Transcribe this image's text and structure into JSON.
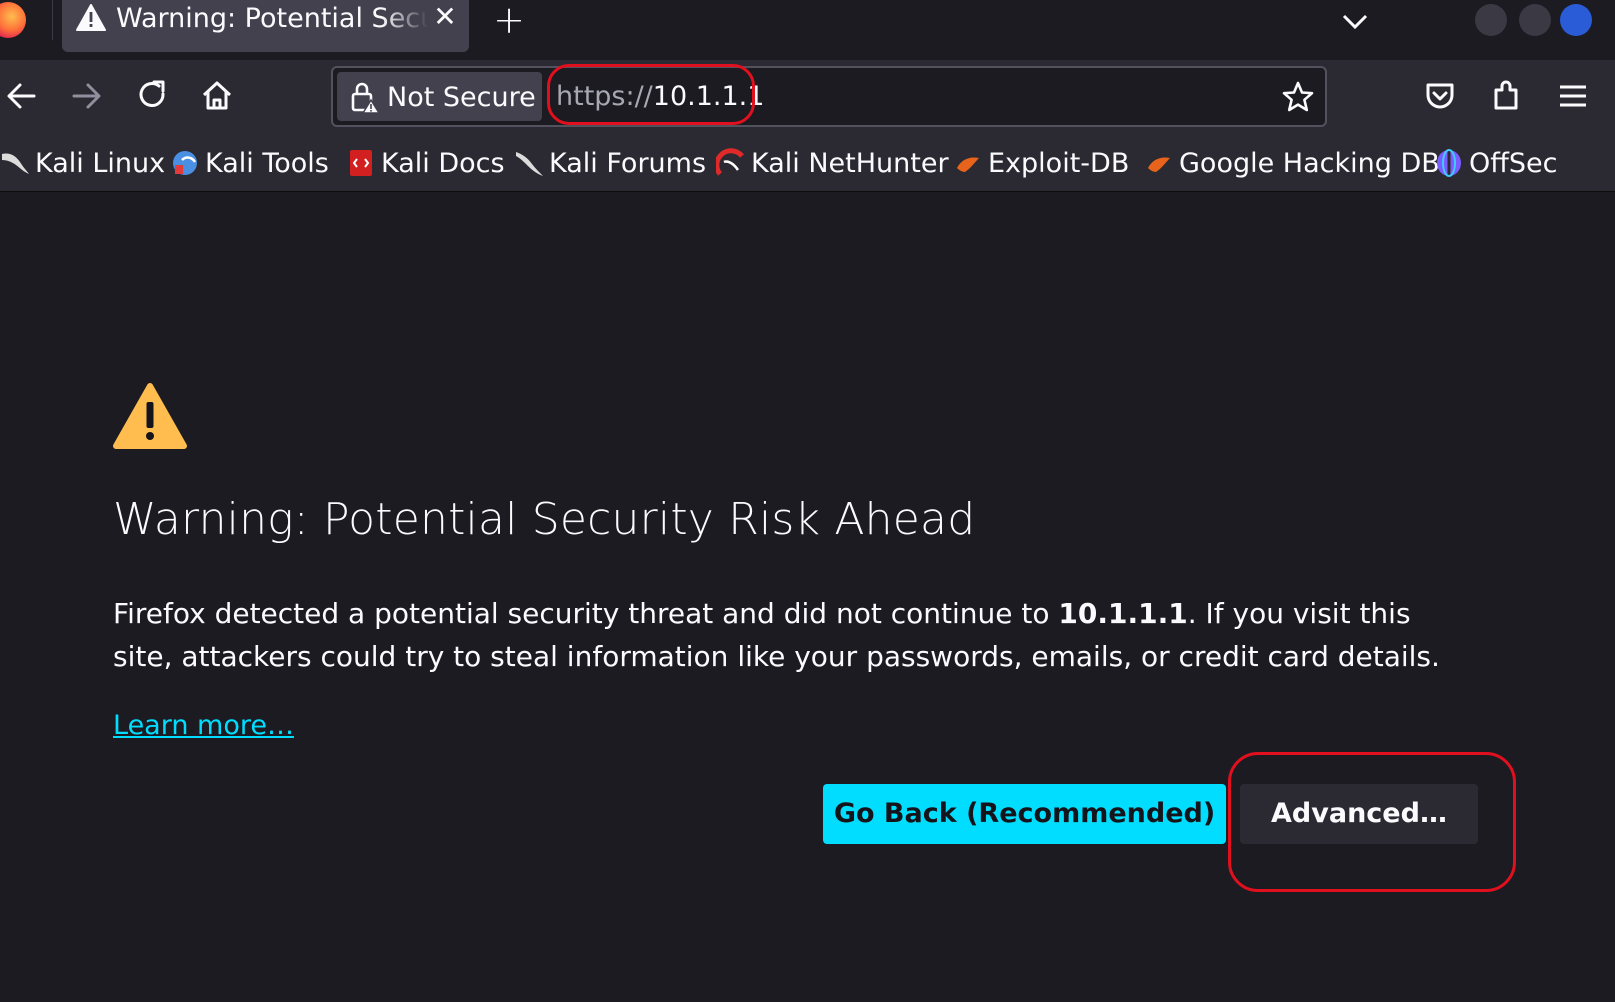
{
  "tab": {
    "title": "Warning: Potential Security Risk Ahead",
    "close_glyph": "✕",
    "icon": "warning-triangle-icon"
  },
  "new_tab_glyph": "+",
  "toolbar": {
    "back_icon": "back-arrow-icon",
    "forward_icon": "forward-arrow-icon",
    "reload_icon": "reload-icon",
    "home_icon": "home-icon",
    "pocket_icon": "pocket-icon",
    "extensions_icon": "extensions-icon",
    "menu_icon": "hamburger-menu-icon"
  },
  "urlbar": {
    "identity_label": "Not Secure",
    "url_scheme": "https://",
    "url_host": "10.1.1.1",
    "bookmark_icon": "star-icon"
  },
  "bookmarks": [
    {
      "label": "Kali Linux",
      "icon": "kali-dragon-icon",
      "color": "#dcdcdc"
    },
    {
      "label": "Kali Tools",
      "icon": "kali-tools-icon",
      "color": "#4a90e2"
    },
    {
      "label": "Kali Docs",
      "icon": "kali-docs-icon",
      "color": "#d21f1f"
    },
    {
      "label": "Kali Forums",
      "icon": "kali-forums-icon",
      "color": "#dcdcdc"
    },
    {
      "label": "Kali NetHunter",
      "icon": "kali-nethunter-icon",
      "color": "#e02a2a"
    },
    {
      "label": "Exploit-DB",
      "icon": "exploit-db-icon",
      "color": "#e8631c"
    },
    {
      "label": "Google Hacking DB",
      "icon": "ghdb-icon",
      "color": "#e8631c"
    },
    {
      "label": "OffSec",
      "icon": "offsec-icon",
      "color": "#7b5cff"
    }
  ],
  "page": {
    "heading": "Warning: Potential Security Risk Ahead",
    "desc_before": "Firefox detected a potential security threat and did not continue to ",
    "desc_host": "10.1.1.1",
    "desc_after": ". If you visit this site, attackers could try to steal information like your passwords, emails, or credit card details.",
    "learn_more": "Learn more…",
    "go_back_label": "Go Back (Recommended)",
    "advanced_label": "Advanced…"
  },
  "colors": {
    "accent": "#00ddff",
    "warning": "#ffbd4f",
    "annotation": "#e0101e",
    "background": "#1c1b22"
  }
}
